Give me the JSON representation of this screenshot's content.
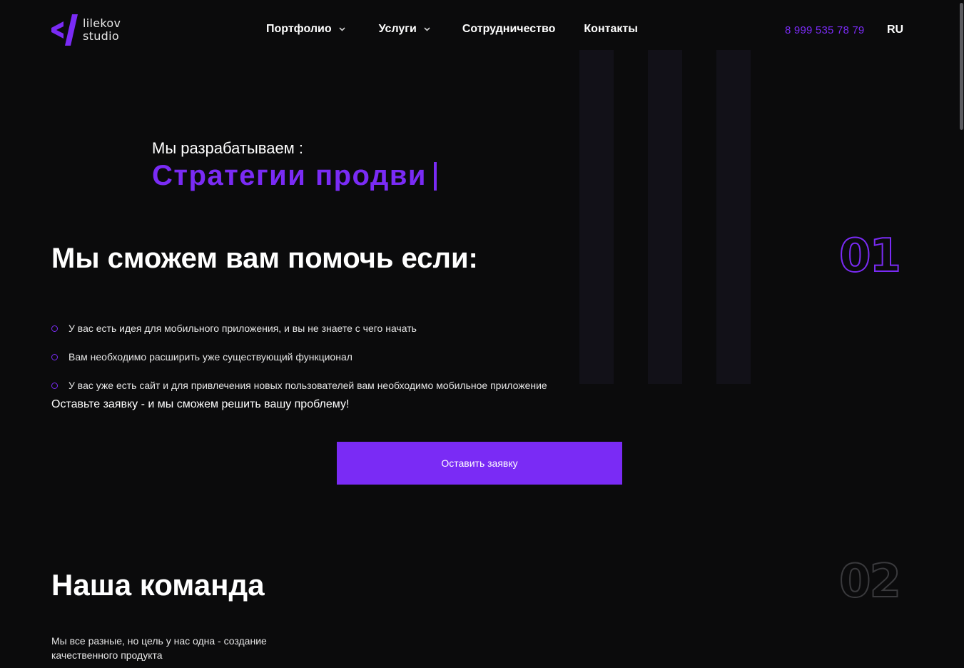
{
  "colors": {
    "background": "#0b0b0c",
    "accent": "#7a2bf5",
    "stripe": "#121118",
    "muted_number": "#3a3a3d"
  },
  "header": {
    "logo": {
      "icon": "code-slash-logo-icon",
      "line1": "lilekov",
      "line2": "studio"
    },
    "nav": [
      {
        "label": "Портфолио",
        "has_dropdown": true
      },
      {
        "label": "Услуги",
        "has_dropdown": true
      },
      {
        "label": "Сотрудничество",
        "has_dropdown": false
      },
      {
        "label": "Контакты",
        "has_dropdown": false
      }
    ],
    "phone": "8 999 535 78 79",
    "language": "RU"
  },
  "hero": {
    "subtitle": "Мы разрабатываем :",
    "typed_text": "Стратегии продви"
  },
  "section_help": {
    "number": "01",
    "title": "Мы сможем вам помочь если:",
    "items": [
      "У вас есть идея для мобильного приложения, и вы не знаете с чего начать",
      "Вам необходимо расширить уже существующий функционал",
      "У вас уже есть сайт и для привлечения новых пользователей вам необходимо мобильное приложение"
    ],
    "cta_text": "Оставьте заявку - и мы сможем решить вашу проблему!",
    "button_label": "Оставить заявку"
  },
  "section_team": {
    "number": "02",
    "title": "Наша команда",
    "description": "Мы все разные, но цель у нас одна - создание качественного продукта"
  }
}
